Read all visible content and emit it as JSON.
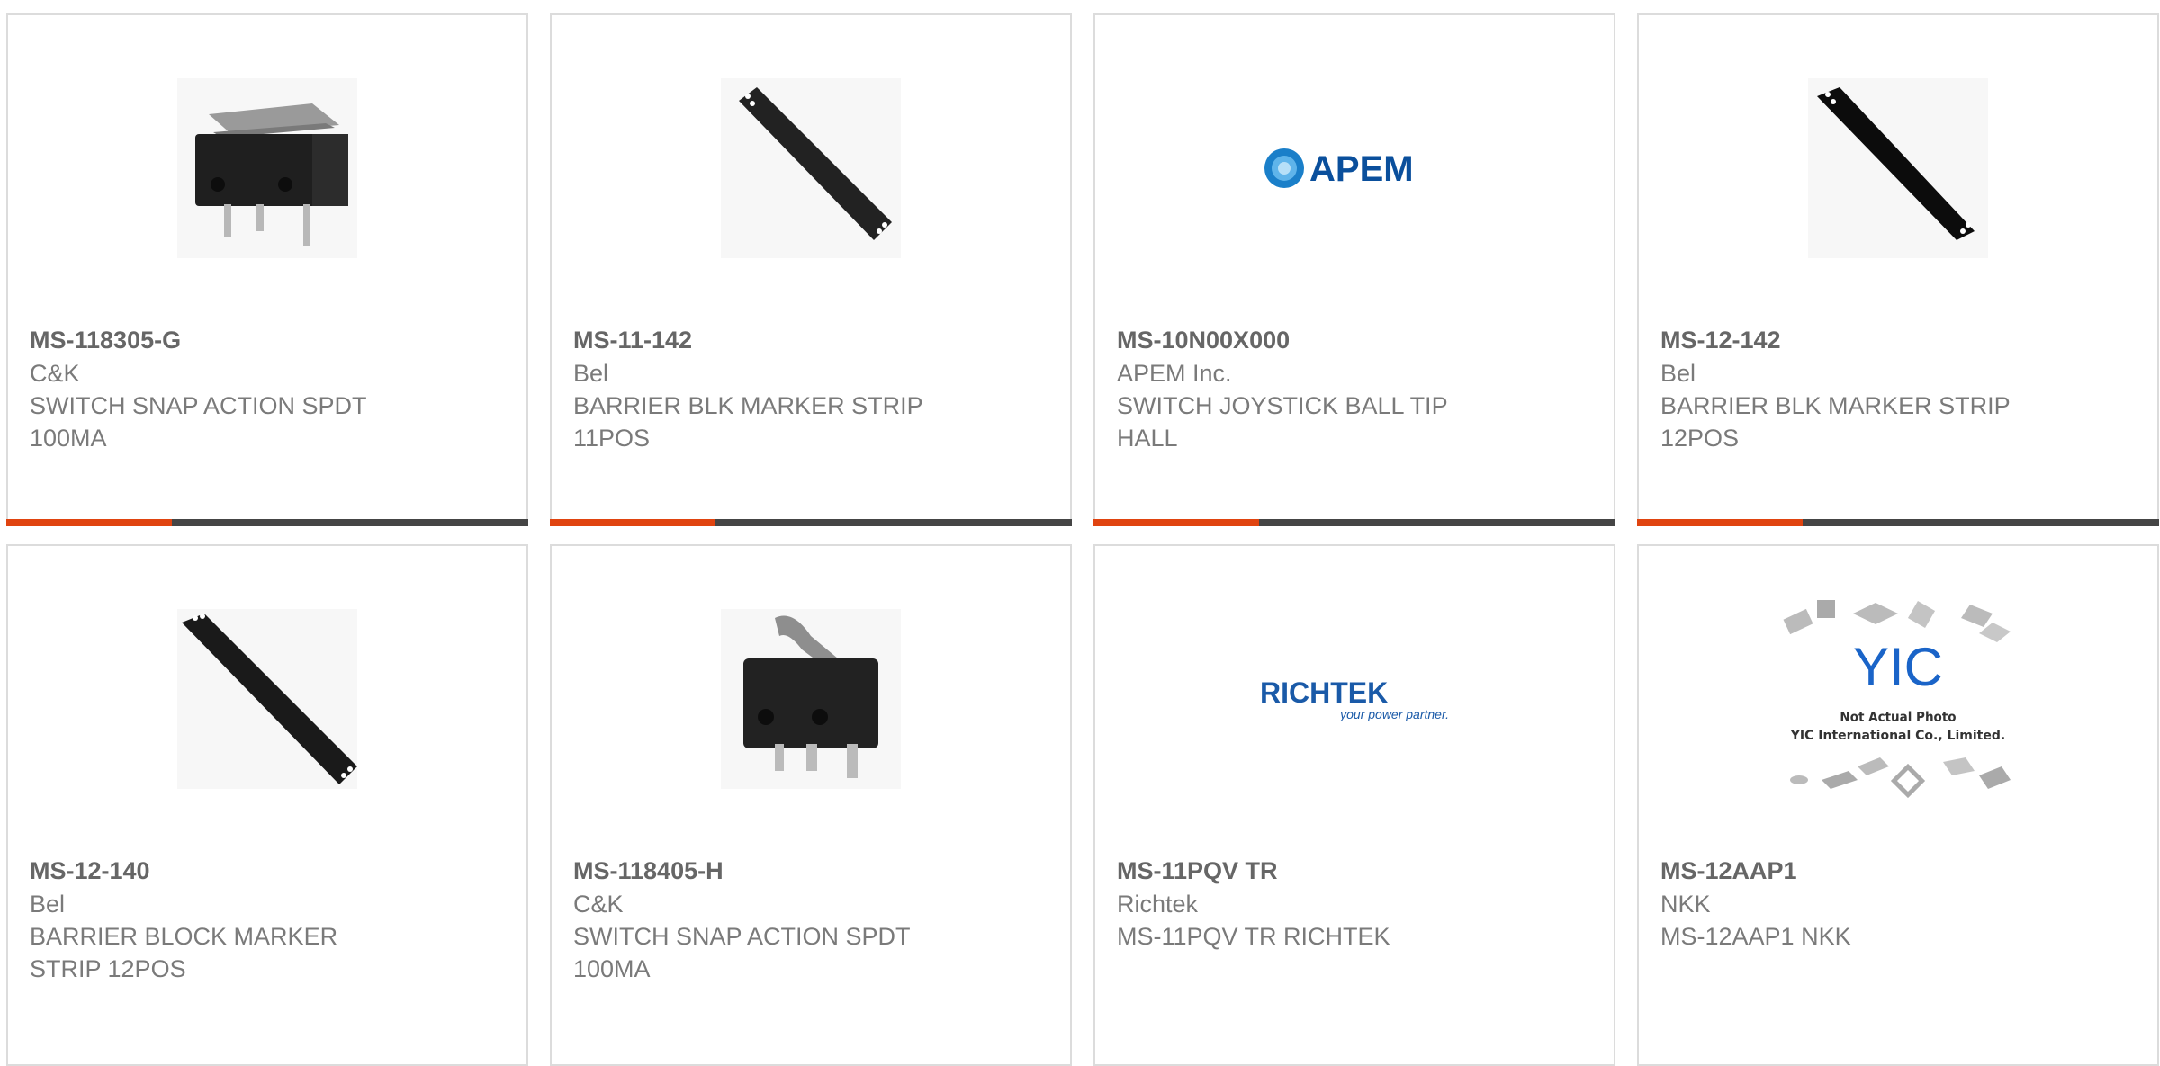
{
  "products": [
    {
      "part_number": "MS-118305-G",
      "manufacturer": "C&K",
      "description": "SWITCH SNAP ACTION SPDT 100MA",
      "image": "snap-switch-lever-image"
    },
    {
      "part_number": "MS-11-142",
      "manufacturer": "Bel",
      "description": "BARRIER BLK MARKER STRIP 11POS",
      "image": "marker-strip-image"
    },
    {
      "part_number": "MS-10N00X000",
      "manufacturer": "APEM Inc.",
      "description": "SWITCH JOYSTICK BALL TIP HALL",
      "image": "apem-logo",
      "logo_text": "APEM"
    },
    {
      "part_number": "MS-12-142",
      "manufacturer": "Bel",
      "description": "BARRIER BLK MARKER STRIP 12POS",
      "image": "marker-strip-image"
    },
    {
      "part_number": "MS-12-140",
      "manufacturer": "Bel",
      "description": "BARRIER BLOCK MARKER STRIP 12POS",
      "image": "marker-strip-image"
    },
    {
      "part_number": "MS-118405-H",
      "manufacturer": "C&K",
      "description": "SWITCH SNAP ACTION SPDT 100MA",
      "image": "snap-switch-lever-image"
    },
    {
      "part_number": "MS-11PQV TR",
      "manufacturer": "Richtek",
      "description": "MS-11PQV TR RICHTEK",
      "image": "richtek-logo",
      "logo_text": "RICHTEK",
      "logo_tagline": "your power partner."
    },
    {
      "part_number": "MS-12AAP1",
      "manufacturer": "NKK",
      "description": "MS-12AAP1 NKK",
      "image": "yic-not-actual-photo",
      "logo_text": "YIC",
      "placeholder_line1": "Not Actual Photo",
      "placeholder_line2": "YIC International Co., Limited."
    }
  ],
  "colors": {
    "accent": "#e04410",
    "bar": "#454545",
    "border": "#dcdcdc",
    "text": "#7a7a7a",
    "apem_blue": "#0a4f9c",
    "richtek_blue": "#1a5aa8"
  }
}
